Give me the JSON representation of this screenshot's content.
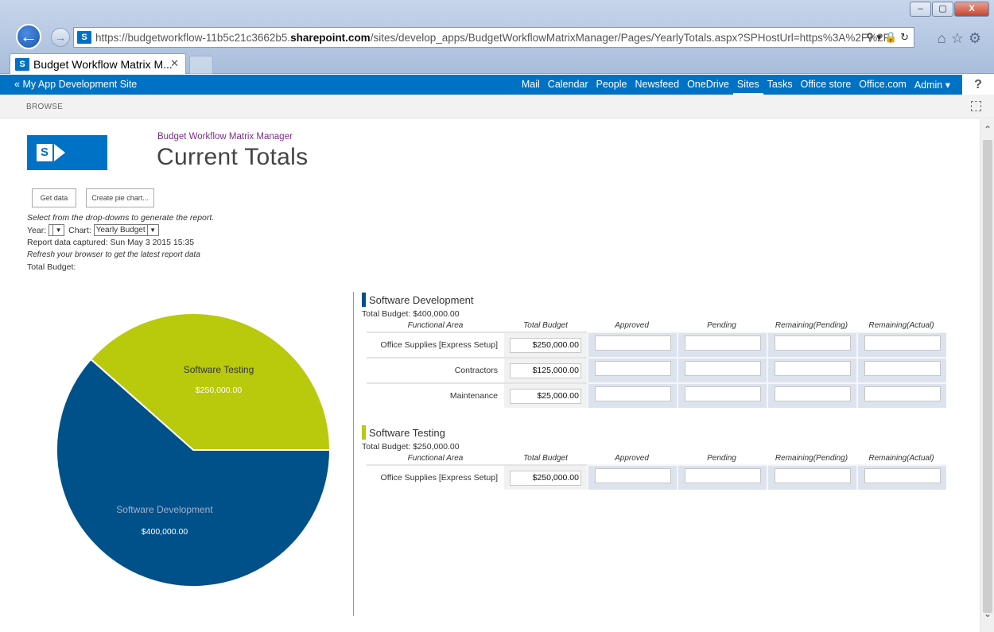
{
  "browser": {
    "url_prefix": "https://budgetworkflow-11b5c21c3662b5.",
    "url_domain": "sharepoint.com",
    "url_suffix": "/sites/develop_apps/BudgetWorkflowMatrixManager/Pages/YearlyTotals.aspx?SPHostUrl=https%3A%2F%2F",
    "tab_title": "Budget Workflow Matrix M...",
    "window_buttons": [
      "–",
      "▢",
      "X"
    ]
  },
  "suitebar": {
    "site_link": "My App Development Site",
    "links": [
      "Mail",
      "Calendar",
      "People",
      "Newsfeed",
      "OneDrive",
      "Sites",
      "Tasks",
      "Office store",
      "Office.com",
      "Admin ▾"
    ],
    "active_link": "Sites",
    "help": "?"
  },
  "ribbon": {
    "tab": "BROWSE"
  },
  "header": {
    "app_name": "Budget Workflow Matrix Manager",
    "page_title": "Current Totals"
  },
  "controls": {
    "get_data": "Get data",
    "create_pie": "Create pie chart...",
    "instructions": "Select from the drop-downs to generate the report.",
    "year_label": "Year:",
    "year_value": "",
    "chart_label": "Chart:",
    "chart_value": "Yearly Budget",
    "captured": "Report data captured: Sun May 3 2015 15:35",
    "refresh": "Refresh your browser to get the latest report data",
    "total_budget": "Total Budget:"
  },
  "colors": {
    "dev": "#00508a",
    "test": "#b9c90c",
    "suitebar": "#0072c6"
  },
  "chart_data": {
    "type": "pie",
    "categories": [
      "Software Testing",
      "Software Development"
    ],
    "values": [
      250000,
      400000
    ],
    "value_labels": [
      "$250,000.00",
      "$400,000.00"
    ],
    "colors": [
      "#b9c90c",
      "#00508a"
    ]
  },
  "columns": [
    "Functional Area",
    "Total Budget",
    "Approved",
    "Pending",
    "Remaining(Pending)",
    "Remaining(Actual)"
  ],
  "sections": [
    {
      "title": "Software Development",
      "total": "Total Budget: $400,000.00",
      "rows": [
        {
          "area": "Office Supplies [Express Setup]",
          "budget": "$250,000.00"
        },
        {
          "area": "Contractors",
          "budget": "$125,000.00"
        },
        {
          "area": "Maintenance",
          "budget": "$25,000.00"
        }
      ]
    },
    {
      "title": "Software Testing",
      "total": "Total Budget: $250,000.00",
      "rows": [
        {
          "area": "Office Supplies [Express Setup]",
          "budget": "$250,000.00"
        }
      ]
    }
  ]
}
